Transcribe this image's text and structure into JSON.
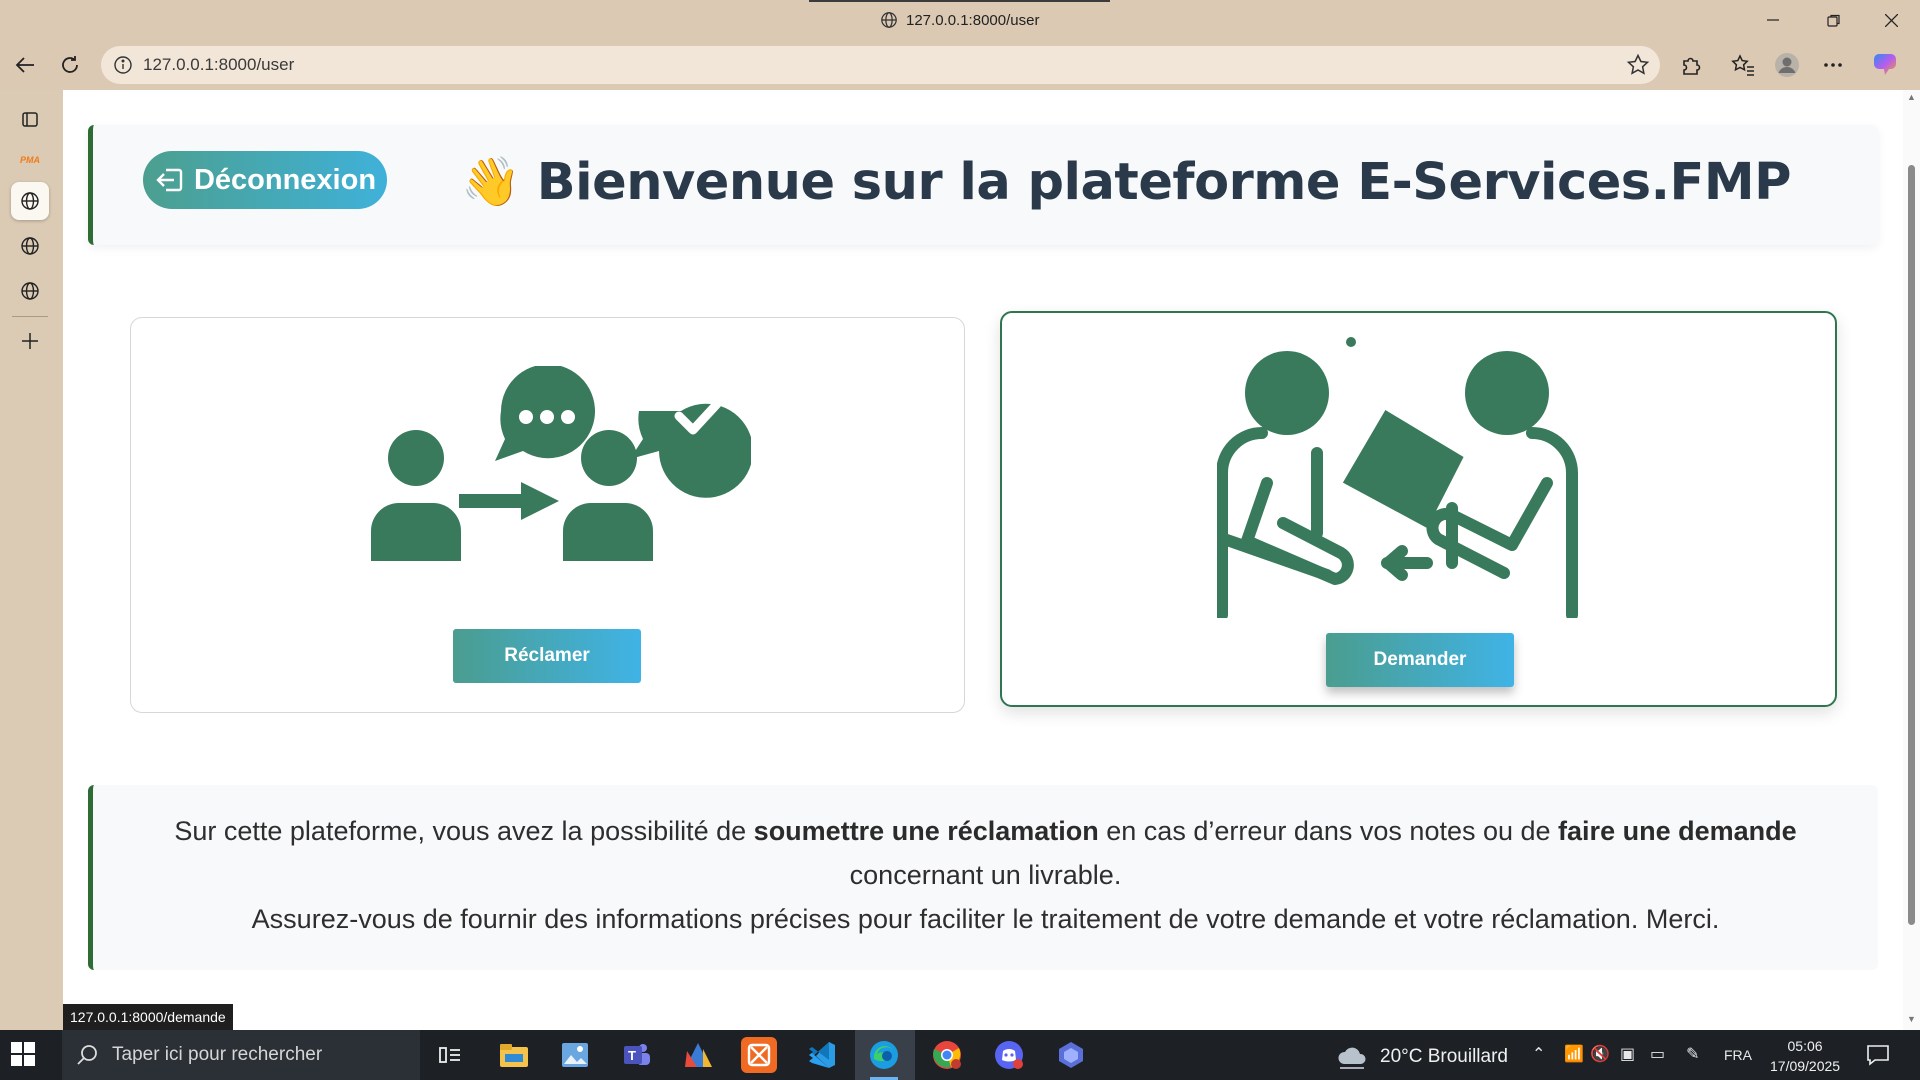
{
  "window": {
    "title": "127.0.0.1:8000/user",
    "controls": [
      "minimize",
      "restore",
      "close"
    ]
  },
  "browser": {
    "url": "127.0.0.1:8000/user",
    "side_tabs": [
      "collections-icon",
      "phpmyadmin-icon",
      "globe-icon",
      "globe-icon",
      "globe-icon",
      "add-icon"
    ],
    "side_tab_pma_label": "PMA"
  },
  "header": {
    "logout_label": "Déconnexion",
    "welcome_emoji": "👋",
    "welcome_text": "Bienvenue sur la plateforme E-Services.FMP"
  },
  "cards": {
    "reclamer": {
      "button": "Réclamer"
    },
    "demander": {
      "button": "Demander"
    }
  },
  "info": {
    "p1_a": "Sur cette plateforme, vous avez la possibilité de ",
    "p1_b": "soumettre une réclamation",
    "p1_c": " en cas d’erreur dans vos notes ou de ",
    "p1_d": "faire une demande",
    "p1_e": " concernant un livrable.",
    "p2": "Assurez-vous de fournir des informations précises pour faciliter le traitement de votre demande et votre réclamation. Merci."
  },
  "status_bar_url": "127.0.0.1:8000/demande",
  "colors": {
    "accent_green": "#3a7a5c",
    "button_gradient_start": "#4a9d8f",
    "button_gradient_end": "#40b3e6",
    "card_border_left": "#2f6b34"
  },
  "taskbar": {
    "search_placeholder": "Taper ici pour rechercher",
    "apps": [
      "task-view",
      "file-explorer",
      "photos",
      "teams",
      "ms-access",
      "xampp",
      "vscode",
      "edge",
      "chrome",
      "discord",
      "copilot"
    ],
    "weather": "20°C  Brouillard",
    "language": "FRA",
    "time": "05:06",
    "date": "17/09/2025"
  }
}
